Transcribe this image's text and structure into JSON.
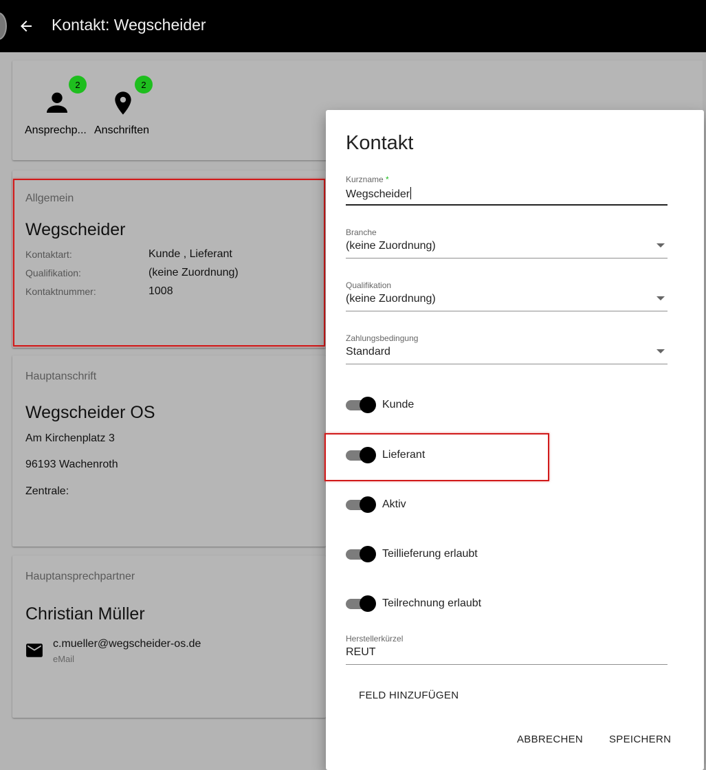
{
  "header": {
    "title": "Kontakt: Wegscheider"
  },
  "summary": {
    "items": [
      {
        "label": "Ansprechp...",
        "badge": "2",
        "icon": "person-icon"
      },
      {
        "label": "Anschriften",
        "badge": "2",
        "icon": "map-pin-icon"
      }
    ]
  },
  "allgemein": {
    "section_title": "Allgemein",
    "name": "Wegscheider",
    "rows": [
      {
        "label": "Kontaktart:",
        "value": "Kunde , Lieferant"
      },
      {
        "label": "Qualifikation:",
        "value": "(keine Zuordnung)"
      },
      {
        "label": "Kontaktnummer:",
        "value": "1008"
      }
    ]
  },
  "hauptanschrift": {
    "section_title": "Hauptanschrift",
    "name": "Wegscheider OS",
    "street": "Am Kirchenplatz 3",
    "city": "96193 Wachenroth",
    "zentrale": "Zentrale:"
  },
  "hauptansprechpartner": {
    "section_title": "Hauptansprechpartner",
    "name": "Christian Müller",
    "email": "c.mueller@wegscheider-os.de",
    "email_label": "eMail"
  },
  "dialog": {
    "title": "Kontakt",
    "kurzname": {
      "label": "Kurzname",
      "required_mark": "*",
      "value": "Wegscheider"
    },
    "branche": {
      "label": "Branche",
      "value": "(keine Zuordnung)"
    },
    "qualifikation": {
      "label": "Qualifikation",
      "value": "(keine Zuordnung)"
    },
    "zahlungsbedingung": {
      "label": "Zahlungsbedingung",
      "value": "Standard"
    },
    "toggles": [
      {
        "label": "Kunde",
        "on": true
      },
      {
        "label": "Lieferant",
        "on": true
      },
      {
        "label": "Aktiv",
        "on": true
      },
      {
        "label": "Teillieferung erlaubt",
        "on": true
      },
      {
        "label": "Teilrechnung erlaubt",
        "on": true
      }
    ],
    "herstellerkuerzel": {
      "label": "Herstellerkürzel",
      "value": "REUT"
    },
    "add_field_label": "FELD HINZUFÜGEN",
    "cancel_label": "ABBRECHEN",
    "save_label": "SPEICHERN"
  },
  "colors": {
    "badge": "#1ebe1e",
    "highlight": "#d11a1a",
    "topbar": "#000000"
  }
}
